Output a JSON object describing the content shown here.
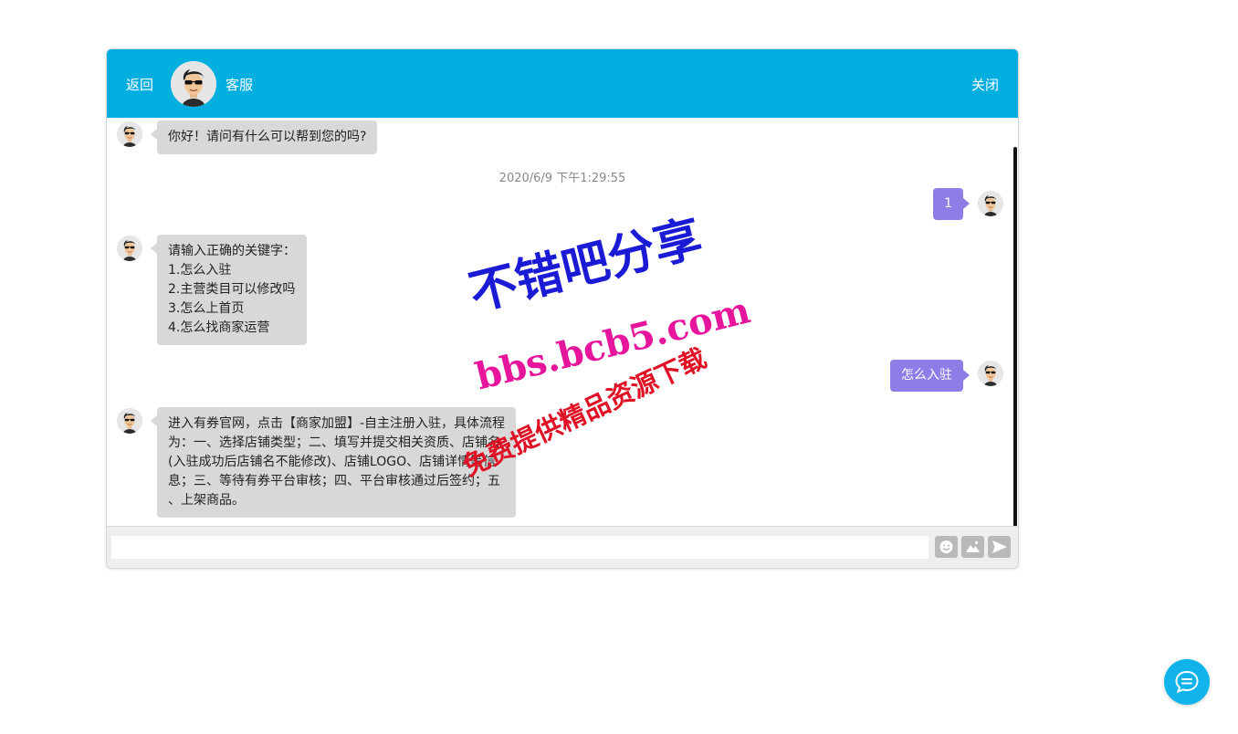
{
  "header": {
    "back_label": "返回",
    "agent_name": "客服",
    "close_label": "关闭",
    "background_color": "#00aee0"
  },
  "messages": {
    "greeting": {
      "sender": "agent",
      "text": "你好！请问有什么可以帮到您的吗?"
    },
    "timestamp": "2020/6/9 下午1:29:55",
    "user_1": {
      "sender": "user",
      "text": "1"
    },
    "keywords": {
      "sender": "agent",
      "lines": [
        "请输入正确的关键字：",
        "1.怎么入驻",
        "2.主营类目可以修改吗",
        "3.怎么上首页",
        "4.怎么找商家运营"
      ]
    },
    "user_2": {
      "sender": "user",
      "text": "怎么入驻"
    },
    "answer": {
      "sender": "agent",
      "lines": [
        "进入有券官网，点击【商家加盟】-自主注册入驻，具体流程",
        "为：一、选择店铺类型；二、填写并提交相关资质、店铺名",
        "(入驻成功后店铺名不能修改)、店铺LOGO、店铺详情等信",
        "息；三、等待有券平台审核；四、平台审核通过后签约；五",
        "、上架商品。"
      ]
    }
  },
  "composer": {
    "value": "",
    "placeholder": "",
    "tools": [
      "emoji-icon",
      "image-icon",
      "send-icon"
    ]
  },
  "watermark": {
    "line1": "不错吧分享",
    "line2": "bbs.bcb5.com",
    "line3": "免费提供精品资源下载"
  },
  "colors": {
    "agent_bubble": "#d8d8d8",
    "user_bubble": "#8c7ee6",
    "fab": "#10b4ea"
  }
}
